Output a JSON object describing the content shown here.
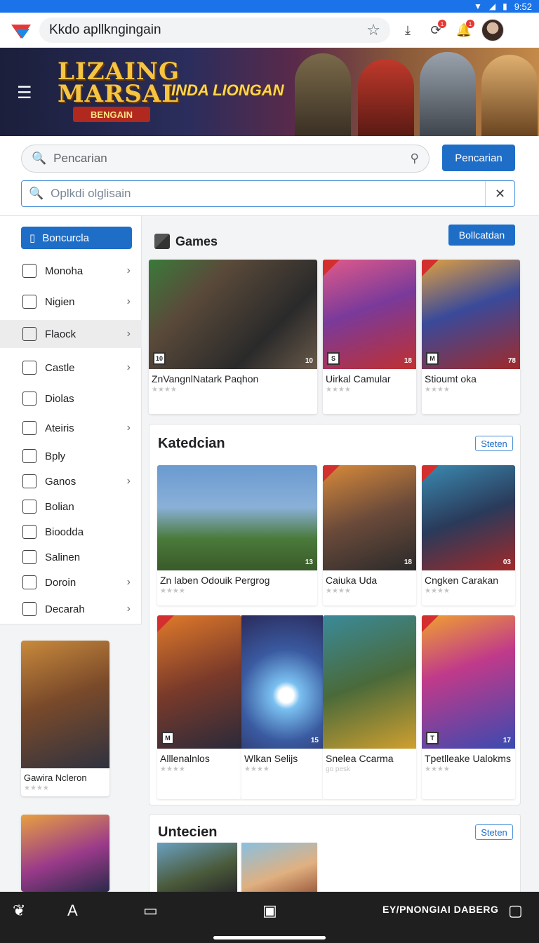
{
  "statusbar": {
    "time": "9:52"
  },
  "browser": {
    "url": "Kkdo apllkngingain",
    "badge_count": "1"
  },
  "banner": {
    "brand": "LIZAING MARSAL",
    "brand_sub": "BENGAIN",
    "tagline": "INDA LIONGAN"
  },
  "search": {
    "placeholder1": "Pencarian",
    "button_label": "Pencarian",
    "placeholder2": "Oplkdi olglisain"
  },
  "sidebar": {
    "active": "Boncurcla",
    "items": [
      {
        "label": "Monoha",
        "chevron": true
      },
      {
        "label": "Nigien",
        "chevron": true
      },
      {
        "label": "Flaock",
        "chevron": true
      },
      {
        "label": "Castle",
        "chevron": true
      },
      {
        "label": "Diolas",
        "chevron": false
      },
      {
        "label": "Ateiris",
        "chevron": true
      },
      {
        "label": "Bply",
        "chevron": false
      },
      {
        "label": "Ganos",
        "chevron": true
      },
      {
        "label": "Bolian",
        "chevron": false
      },
      {
        "label": "Bioodda",
        "chevron": false
      },
      {
        "label": "Salinen",
        "chevron": false
      },
      {
        "label": "Doroin",
        "chevron": true
      },
      {
        "label": "Decarah",
        "chevron": true
      }
    ]
  },
  "left_cards": [
    {
      "title": "Gawira Ncleron",
      "stars": "★★★★"
    },
    {
      "title": "",
      "stars": ""
    }
  ],
  "games": {
    "title": "Games",
    "action": "Bollcatdan",
    "cards": [
      {
        "title": "ZnVangnlNatark Paqhon",
        "stars": "★★★★",
        "num": "10"
      },
      {
        "title": "Uirkal Camular",
        "stars": "★★★★",
        "num": "18"
      },
      {
        "title": "Stioumt oka",
        "stars": "★★★★",
        "num": "78"
      }
    ]
  },
  "kategori": {
    "title": "Katedcian",
    "action": "Steten",
    "cards": [
      {
        "title": "Zn laben Odouik Pergrog",
        "stars": "★★★★",
        "num": "13"
      },
      {
        "title": "Caiuka Uda",
        "stars": "★★★★",
        "num": "18"
      },
      {
        "title": "Cngken Carakan",
        "stars": "★★★★",
        "num": "03"
      },
      {
        "title": "Alllenalnlos",
        "stars": "★★★★",
        "num": ""
      },
      {
        "title": "Wlkan Selijs",
        "stars": "★★★★",
        "num": "15"
      },
      {
        "title": "Snelea Ccarma",
        "stars": "go pesk",
        "num": ""
      },
      {
        "title": "Tpetlleake Ualokms",
        "stars": "★★★★",
        "num": "17"
      }
    ]
  },
  "untecien": {
    "title": "Untecien",
    "action": "Steten"
  },
  "bottomnav": {
    "label": "EY/PNONGIAI DABERG"
  },
  "colors": {
    "accent": "#1e6ec8",
    "statusbar": "#1a73e8",
    "nav": "#1f1f1f"
  }
}
